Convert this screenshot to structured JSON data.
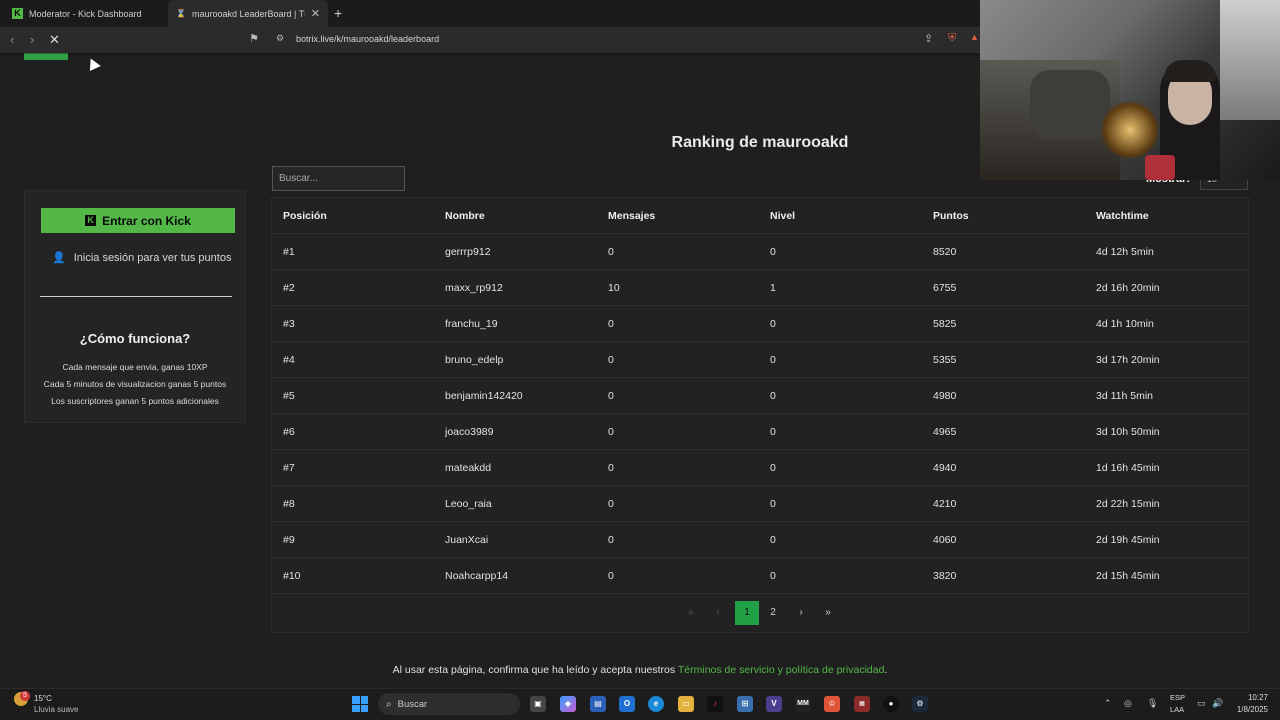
{
  "browser": {
    "tabs": [
      {
        "title": "Moderator - Kick Dashboard",
        "active": false
      },
      {
        "title": "maurooakd LeaderBoard | The b",
        "active": true
      }
    ],
    "new_tab": "+",
    "url": "botrix.live/k/maurooakd/leaderboard"
  },
  "page": {
    "title": "Ranking de maurooakd",
    "search_placeholder": "Buscar...",
    "show_label": "Mostrar:",
    "show_value": "10"
  },
  "sidebar": {
    "login_button": "Entrar con Kick",
    "login_hint": "Inicia sesión para ver tus puntos",
    "how_title": "¿Cómo funciona?",
    "how_lines": [
      "Cada mensaje que envia, ganas 10XP",
      "Cada 5 minutos de visualizacion ganas 5 puntos",
      "Los suscriptores ganan 5 puntos adicionales"
    ]
  },
  "table": {
    "headers": [
      "Posición",
      "Nombre",
      "Mensajes",
      "Nivel",
      "Puntos",
      "Watchtime"
    ],
    "rows": [
      [
        "#1",
        "gerrrp912",
        "0",
        "0",
        "8520",
        "4d 12h 5min"
      ],
      [
        "#2",
        "maxx_rp912",
        "10",
        "1",
        "6755",
        "2d 16h 20min"
      ],
      [
        "#3",
        "franchu_19",
        "0",
        "0",
        "5825",
        "4d 1h 10min"
      ],
      [
        "#4",
        "bruno_edelp",
        "0",
        "0",
        "5355",
        "3d 17h 20min"
      ],
      [
        "#5",
        "benjamin142420",
        "0",
        "0",
        "4980",
        "3d 11h 5min"
      ],
      [
        "#6",
        "joaco3989",
        "0",
        "0",
        "4965",
        "3d 10h 50min"
      ],
      [
        "#7",
        "mateakdd",
        "0",
        "0",
        "4940",
        "1d 16h 45min"
      ],
      [
        "#8",
        "Leoo_raia",
        "0",
        "0",
        "4210",
        "2d 22h 15min"
      ],
      [
        "#9",
        "JuanXcai",
        "0",
        "0",
        "4060",
        "2d 19h 45min"
      ],
      [
        "#10",
        "Noahcarpp14",
        "0",
        "0",
        "3820",
        "2d 15h 45min"
      ]
    ]
  },
  "pagination": {
    "first": "«",
    "prev": "‹",
    "pages": [
      "1",
      "2"
    ],
    "next": "›",
    "last": "»"
  },
  "footer": {
    "text": "Al usar esta página, confirma que ha leído y acepta nuestros ",
    "link": "Términos de servicio y política de privacidad",
    "end": "."
  },
  "taskbar": {
    "weather_badge": "5",
    "temp": "15°C",
    "weather": "Lluvia suave",
    "search": "Buscar",
    "lang1": "ESP",
    "lang2": "LAA",
    "time": "10:27",
    "date": "1/8/2025"
  },
  "colors": {
    "accent": "#53b848",
    "page_active": "#22a046",
    "background": "#1f1f1f"
  }
}
